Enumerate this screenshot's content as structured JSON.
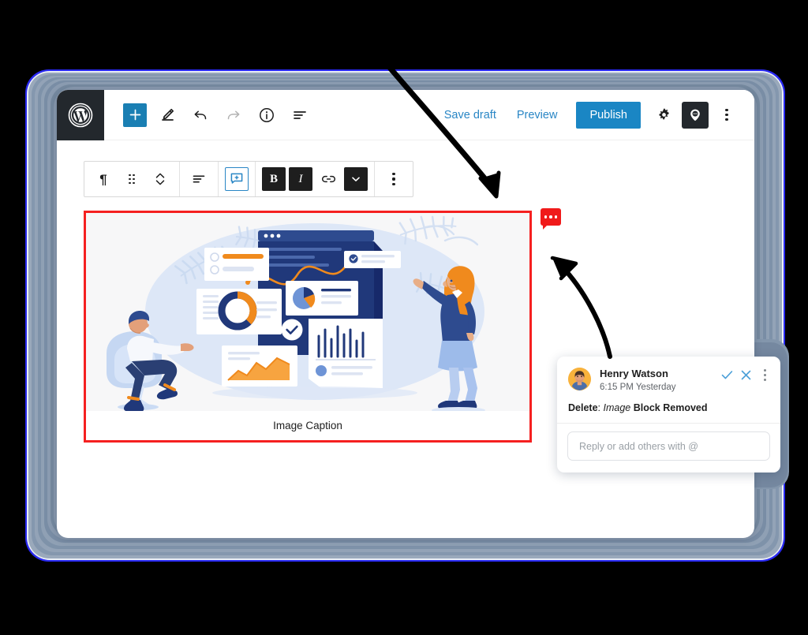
{
  "app": {
    "name": "WordPress Block Editor",
    "logo_icon": "wordpress-logo-icon"
  },
  "header": {
    "left_tools": [
      {
        "name": "add-block",
        "icon": "plus-icon",
        "label": "+"
      },
      {
        "name": "edit-mode",
        "icon": "pencil-icon"
      },
      {
        "name": "undo",
        "icon": "undo-arrow-icon"
      },
      {
        "name": "redo",
        "icon": "redo-arrow-icon"
      },
      {
        "name": "details",
        "icon": "info-circle-icon"
      },
      {
        "name": "list-view",
        "icon": "list-view-icon"
      }
    ],
    "save_draft_label": "Save draft",
    "preview_label": "Preview",
    "publish_label": "Publish",
    "settings_icon": "gear-icon",
    "comments_icon": "comment-pin-icon",
    "more_icon": "kebab-menu-icon",
    "link_color": "#2986c5",
    "publish_bg": "#1a86c4"
  },
  "block_toolbar": {
    "items": [
      {
        "name": "block-type-paragraph",
        "icon": "paragraph-icon",
        "glyph": "¶"
      },
      {
        "name": "drag-handle",
        "icon": "drag-grip-icon"
      },
      {
        "name": "move-up-down",
        "icon": "chevron-up-down-icon"
      },
      {
        "name": "align-text",
        "icon": "align-left-icon"
      },
      {
        "name": "add-comment",
        "icon": "add-comment-icon"
      },
      {
        "name": "bold",
        "icon": "bold-icon",
        "glyph": "B"
      },
      {
        "name": "italic",
        "icon": "italic-icon",
        "glyph": "I"
      },
      {
        "name": "link",
        "icon": "link-icon"
      },
      {
        "name": "more-formatting",
        "icon": "chevron-down-icon"
      },
      {
        "name": "block-options",
        "icon": "kebab-menu-icon"
      }
    ]
  },
  "content": {
    "image_block": {
      "caption": "Image Caption",
      "selected_border_color": "#f52020",
      "illustration_alt": "business-analytics-illustration"
    }
  },
  "comment_badge": {
    "icon": "comment-dots-icon",
    "color": "#f01a1a",
    "dots": 3
  },
  "comment_popup": {
    "author": "Henry Watson",
    "timestamp": "6:15 PM Yesterday",
    "resolve_icon": "check-icon",
    "close_icon": "close-x-icon",
    "more_icon": "kebab-menu-icon",
    "message": {
      "prefix_bold": "Delete",
      "separator": ": ",
      "italic": "Image",
      "suffix_bold": "Block Removed"
    },
    "reply_placeholder": "Reply or add others with @",
    "avatar_icon": "user-avatar"
  },
  "annotations": {
    "arrow_to_comment_icon": "curved-arrow-down-right",
    "arrow_to_comment_badge": "curved-arrow-up-left"
  },
  "theme": {
    "page_background": "#000000",
    "window_background": "#ffffff",
    "stack_layer_color": "#7f93ab"
  }
}
